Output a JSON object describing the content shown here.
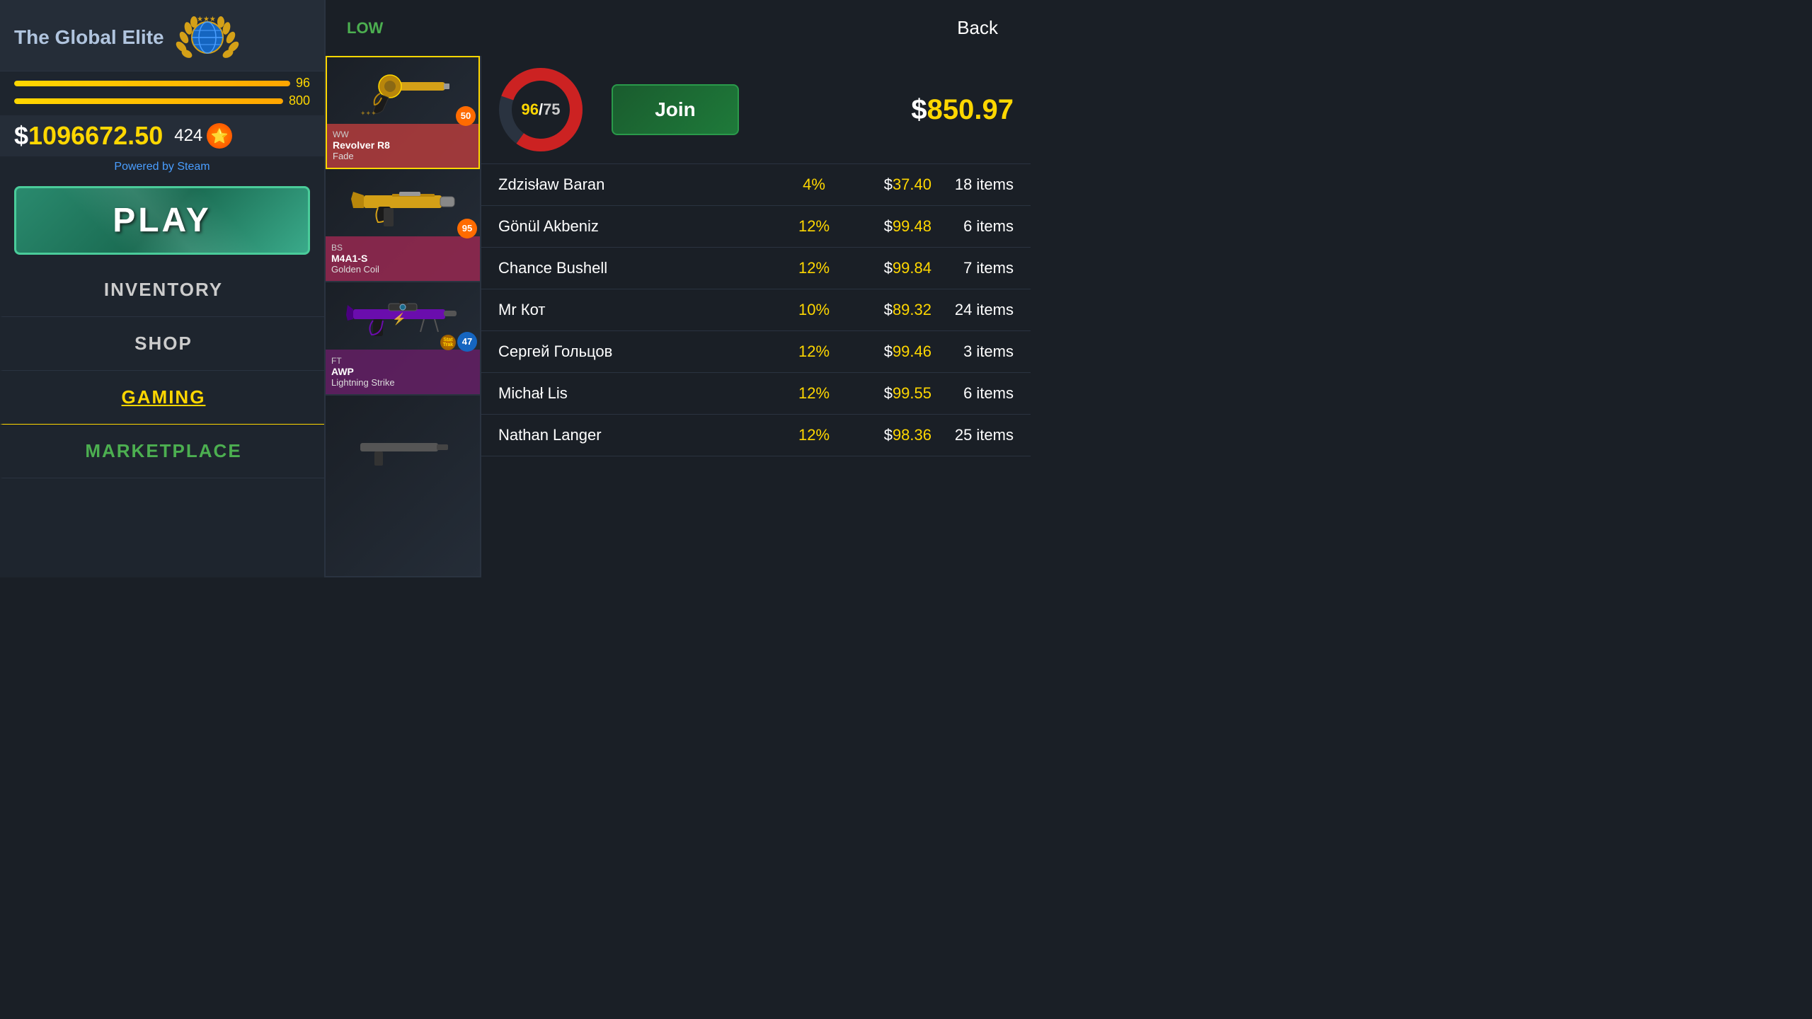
{
  "sidebar": {
    "rank_name": "The Global Elite",
    "xp_current": 800,
    "xp_max": 800,
    "balance": "1096672.50",
    "stars": "424",
    "powered_by_prefix": "Powered by",
    "powered_by_brand": "Steam",
    "play_label": "PLAY",
    "nav_items": [
      {
        "id": "inventory",
        "label": "INVENTORY",
        "state": "normal"
      },
      {
        "id": "shop",
        "label": "SHOP",
        "state": "normal"
      },
      {
        "id": "gaming",
        "label": "GAMING",
        "state": "active-gaming"
      },
      {
        "id": "marketplace",
        "label": "MARKETPLACE",
        "state": "active-marketplace"
      }
    ]
  },
  "header": {
    "status": "LOW",
    "back_label": "Back"
  },
  "weapons": [
    {
      "id": "revolver-fade",
      "rarity": "WW",
      "name": "Revolver R8",
      "skin": "Fade",
      "count": 50,
      "badge_color": "badge-orange",
      "selected": true,
      "stattrak": false,
      "gun_type": "revolver",
      "gun_color": "#d4a017"
    },
    {
      "id": "m4a1-golden",
      "rarity": "BS",
      "name": "M4A1-S",
      "skin": "Golden Coil",
      "count": 95,
      "badge_color": "badge-orange",
      "selected": false,
      "stattrak": false,
      "gun_type": "rifle",
      "gun_color": "#d4a017"
    },
    {
      "id": "awp-lightning",
      "rarity": "FT",
      "name": "AWP",
      "skin": "Lightning Strike",
      "count": 47,
      "badge_color": "badge-blue",
      "selected": false,
      "stattrak": true,
      "gun_type": "sniper",
      "gun_color": "#8a2be2"
    }
  ],
  "match": {
    "players_current": 96,
    "players_max": 75,
    "pot_value": "850.97",
    "join_label": "Join",
    "donut_fill_percent": 96,
    "donut_color": "#cc2222",
    "donut_bg_color": "#2a3340"
  },
  "players": [
    {
      "name": "Zdzisław Baran",
      "percent": "4%",
      "value": "37.40",
      "items": "18 items"
    },
    {
      "name": "Gönül Akbeniz",
      "percent": "12%",
      "value": "99.48",
      "items": "6 items"
    },
    {
      "name": "Chance Bushell",
      "percent": "12%",
      "value": "99.84",
      "items": "7 items"
    },
    {
      "name": "Mr Кот",
      "percent": "10%",
      "value": "89.32",
      "items": "24 items"
    },
    {
      "name": "Сергей Гольцов",
      "percent": "12%",
      "value": "99.46",
      "items": "3 items"
    },
    {
      "name": "Michał Lis",
      "percent": "12%",
      "value": "99.55",
      "items": "6 items"
    },
    {
      "name": "Nathan Langer",
      "percent": "12%",
      "value": "98.36",
      "items": "25 items"
    }
  ]
}
